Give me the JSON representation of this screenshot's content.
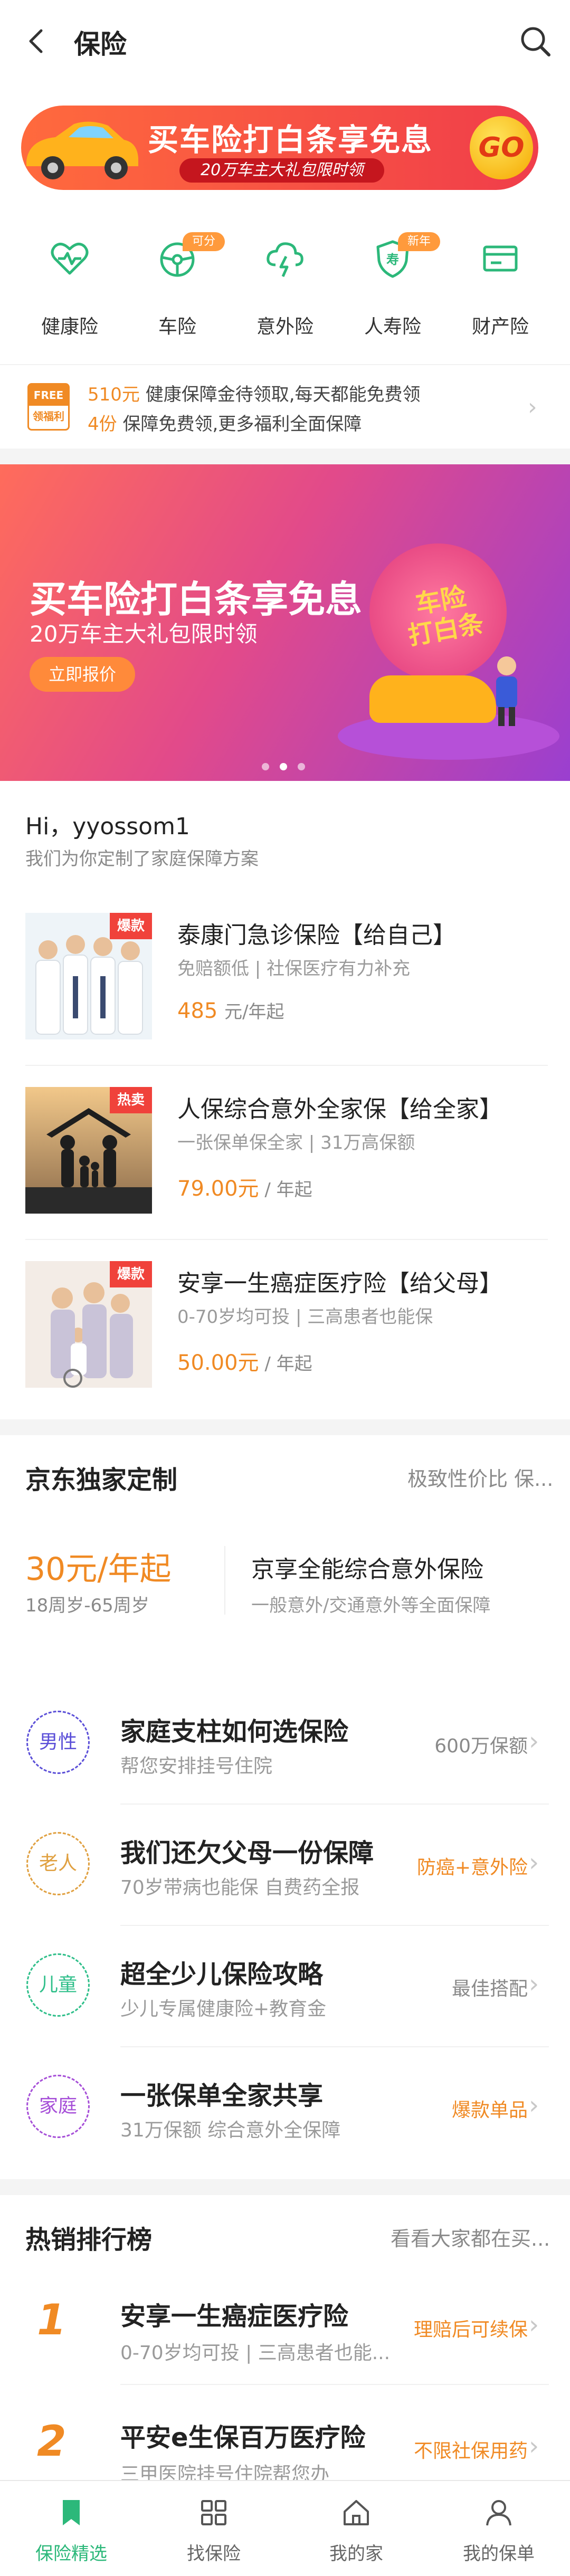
{
  "header": {
    "back_icon": "chevron-left-icon",
    "title": "保险",
    "search_icon": "search-icon"
  },
  "promo_banner": {
    "title": "买车险打白条享免息",
    "subtitle": "20万车主大礼包限时领",
    "go_label": "GO"
  },
  "categories": [
    {
      "label": "健康险",
      "icon": "heart-pulse-icon",
      "tag": ""
    },
    {
      "label": "车险",
      "icon": "steering-wheel-icon",
      "tag": "可分期"
    },
    {
      "label": "意外险",
      "icon": "cloud-lightning-icon",
      "tag": ""
    },
    {
      "label": "人寿险",
      "icon": "shield-life-icon",
      "tag": "新年金"
    },
    {
      "label": "财产险",
      "icon": "card-icon",
      "tag": ""
    }
  ],
  "free_row": {
    "badge_top": "FREE",
    "badge_bottom": "领福利",
    "line1_highlight": "510元",
    "line1_text": "健康保障金待领取,每天都能免费领",
    "line2_highlight": "4份",
    "line2_text": "保障免费领,更多福利全面保障"
  },
  "main_banner": {
    "title": "买车险打白条享免息",
    "subtitle": "20万车主大礼包限时领",
    "button": "立即报价",
    "badge_text": "车险 打白条"
  },
  "greeting": {
    "hi": "Hi，yyossom1",
    "sub": "我们为你定制了家庭保障方案"
  },
  "products": [
    {
      "tag": "爆款",
      "title": "泰康门急诊保险【给自己】",
      "desc": "免赔额低 | 社保医疗有力补充",
      "price": "485",
      "unit": "元/年起"
    },
    {
      "tag": "热卖",
      "title": "人保综合意外全家保【给全家】",
      "desc": "一张保单保全家 | 31万高保额",
      "price": "79.00元",
      "unit": " / 年起"
    },
    {
      "tag": "爆款",
      "title": "安享一生癌症医疗险【给父母】",
      "desc": "0-70岁均可投 | 三高患者也能保",
      "price": "50.00元",
      "unit": " / 年起"
    }
  ],
  "jd_section": {
    "title": "京东独家定制",
    "more": "极致性价比 保...",
    "price": "30元/年起",
    "age": "18周岁-65周岁",
    "name": "京享全能综合意外保险",
    "desc": "一般意外/交通意外等全面保障"
  },
  "guides": [
    {
      "circle": "男性",
      "color": "#5b4fd8",
      "title": "家庭支柱如何选保险",
      "sub": "帮您安排挂号住院",
      "right": "600万保额",
      "right_color": "#8a8a8a"
    },
    {
      "circle": "老人",
      "color": "#e0a040",
      "title": "我们还欠父母一份保障",
      "sub": "70岁带病也能保 自费药全报",
      "right": "防癌+意外险",
      "right_color": "#f08a24"
    },
    {
      "circle": "儿童",
      "color": "#2fbf8a",
      "title": "超全少儿保险攻略",
      "sub": "少儿专属健康险+教育金",
      "right": "最佳搭配",
      "right_color": "#8a8a8a"
    },
    {
      "circle": "家庭",
      "color": "#a64fd8",
      "title": "一张保单全家共享",
      "sub": "31万保额 综合意外全保障",
      "right": "爆款单品",
      "right_color": "#f08a24"
    }
  ],
  "hot_rank": {
    "title": "热销排行榜",
    "more": "看看大家都在买...",
    "items": [
      {
        "num": "1",
        "title": "安享一生癌症医疗险",
        "sub": "0-70岁均可投 | 三高患者也能...",
        "tag": "理赔后可续保"
      },
      {
        "num": "2",
        "title": "平安e生保百万医疗险",
        "sub": "三甲医院挂号住院帮您办",
        "tag": "不限社保用药"
      }
    ]
  },
  "bottom_nav": [
    {
      "label": "保险精选",
      "icon": "bookmark-icon",
      "active": true
    },
    {
      "label": "找保险",
      "icon": "grid-icon",
      "active": false
    },
    {
      "label": "我的家",
      "icon": "home-icon",
      "active": false
    },
    {
      "label": "我的保单",
      "icon": "person-icon",
      "active": false
    }
  ],
  "colors": {
    "accent_green": "#2cb87a",
    "accent_orange": "#f08a24",
    "tag_red": "#f0423b"
  }
}
